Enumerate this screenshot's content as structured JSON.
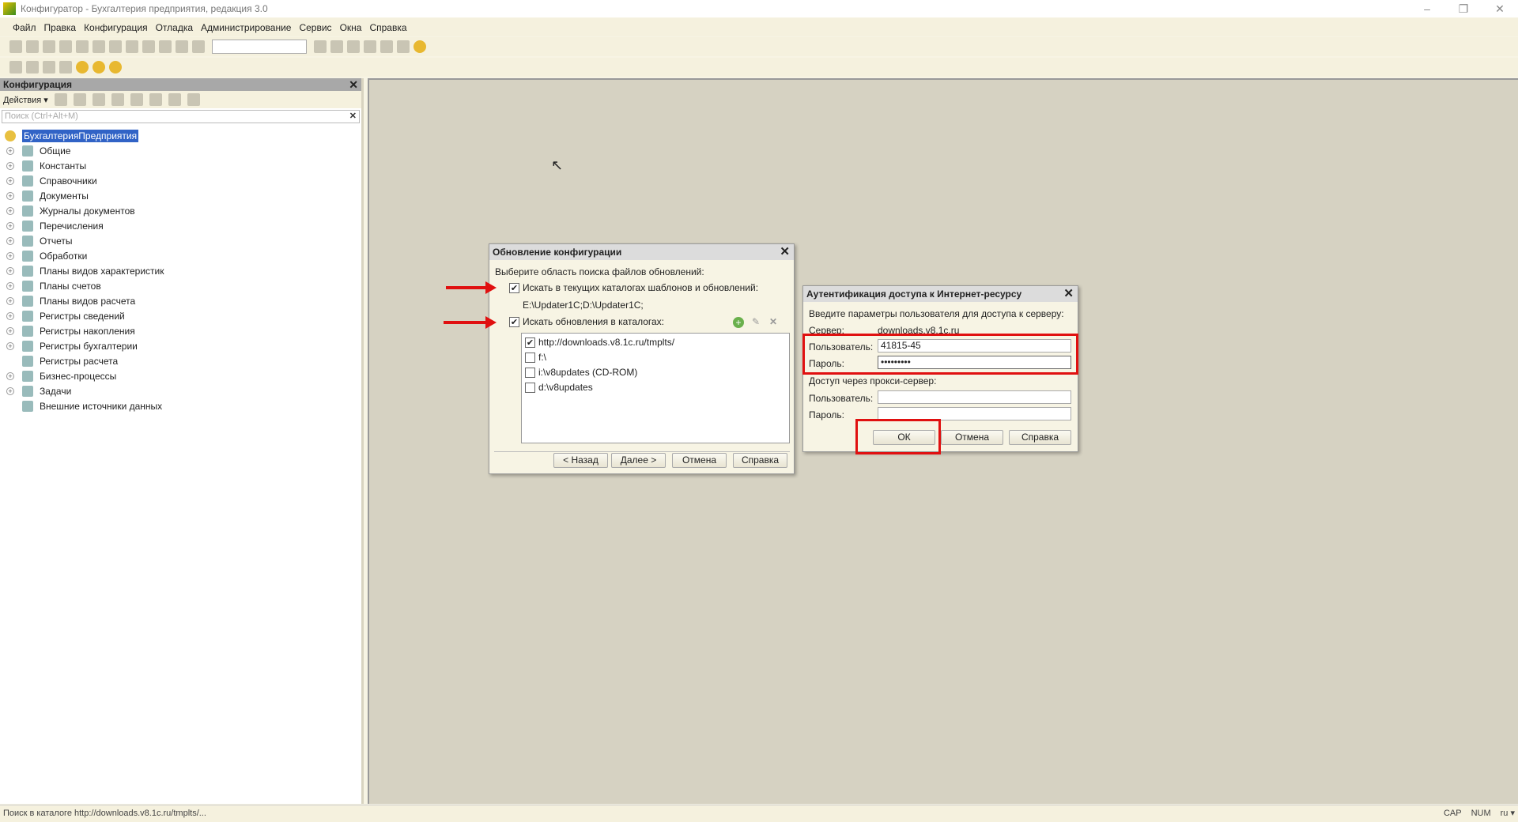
{
  "window": {
    "title": "Конфигуратор - Бухгалтерия предприятия, редакция 3.0",
    "min": "–",
    "restore": "❐",
    "close": "✕"
  },
  "menu": [
    "Файл",
    "Правка",
    "Конфигурация",
    "Отладка",
    "Администрирование",
    "Сервис",
    "Окна",
    "Справка"
  ],
  "left_panel": {
    "title": "Конфигурация",
    "actions_label": "Действия ▾",
    "search_placeholder": "Поиск (Ctrl+Alt+M)",
    "close": "✕",
    "root": "БухгалтерияПредприятия",
    "items": [
      "Общие",
      "Константы",
      "Справочники",
      "Документы",
      "Журналы документов",
      "Перечисления",
      "Отчеты",
      "Обработки",
      "Планы видов характеристик",
      "Планы счетов",
      "Планы видов расчета",
      "Регистры сведений",
      "Регистры накопления",
      "Регистры бухгалтерии",
      "Регистры расчета",
      "Бизнес-процессы",
      "Задачи",
      "Внешние источники данных"
    ]
  },
  "update_dialog": {
    "title": "Обновление конфигурации",
    "prompt": "Выберите область поиска файлов обновлений:",
    "opt1": "Искать в текущих каталогах шаблонов и обновлений:",
    "opt1_paths": "E:\\Updater1C;D:\\Updater1C;",
    "opt2": "Искать обновления в каталогах:",
    "catalogs": [
      {
        "path": "http://downloads.v8.1c.ru/tmplts/",
        "checked": true
      },
      {
        "path": "f:\\",
        "checked": false
      },
      {
        "path": "i:\\v8updates (CD-ROM)",
        "checked": false
      },
      {
        "path": "d:\\v8updates",
        "checked": false
      }
    ],
    "buttons": {
      "back": "< Назад",
      "next": "Далее >",
      "cancel": "Отмена",
      "help": "Справка"
    }
  },
  "auth_dialog": {
    "title": "Аутентификация доступа к Интернет-ресурсу",
    "prompt": "Введите параметры пользователя для доступа к серверу:",
    "server_label": "Сервер:",
    "server": "downloads.v8.1c.ru",
    "user_label": "Пользователь:",
    "user": "41815-45",
    "password_label": "Пароль:",
    "password": "•••••••••",
    "proxy_label": "Доступ через прокси-сервер:",
    "proxy_user_label": "Пользователь:",
    "proxy_password_label": "Пароль:",
    "buttons": {
      "ok": "ОК",
      "cancel": "Отмена",
      "help": "Справка"
    }
  },
  "status": {
    "text": "Поиск в каталоге http://downloads.v8.1c.ru/tmplts/...",
    "cap": "CAP",
    "num": "NUM",
    "lang": "ru ▾"
  },
  "colors": {
    "highlight": "#e01010",
    "selection": "#3163c6"
  }
}
